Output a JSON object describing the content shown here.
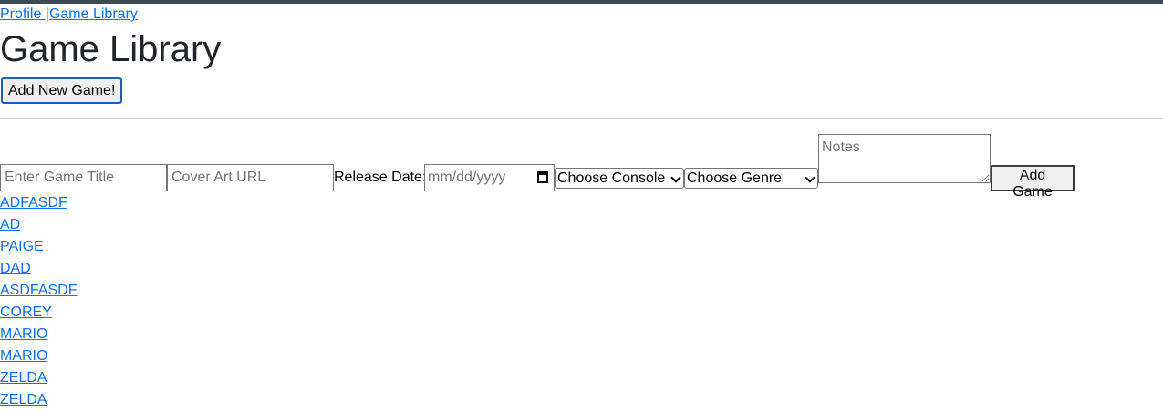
{
  "nav": {
    "profile_label": "Profile |",
    "library_label": "Game Library"
  },
  "page": {
    "title": "Game Library"
  },
  "toolbar": {
    "add_new_label": "Add New Game!"
  },
  "form": {
    "title_placeholder": "Enter Game Title",
    "cover_placeholder": "Cover Art URL",
    "release_label": "Release Date:",
    "date_placeholder": "mm/dd/yyyy",
    "console_selected": "Choose Console",
    "genre_selected": "Choose Genre",
    "notes_placeholder": "Notes",
    "submit_label": "Add Game"
  },
  "games": [
    "ADFASDF",
    "AD",
    "PAIGE",
    "DAD",
    "ASDFASDF",
    "COREY",
    "MARIO",
    "MARIO",
    "ZELDA",
    "ZELDA"
  ],
  "colors": {
    "link": "#0d6efd",
    "top_strip": "#3d4a52",
    "button_focus": "#1a5fb4"
  },
  "icons": {
    "calendar": "calendar-icon",
    "dropdown": "chevron-down-icon"
  }
}
